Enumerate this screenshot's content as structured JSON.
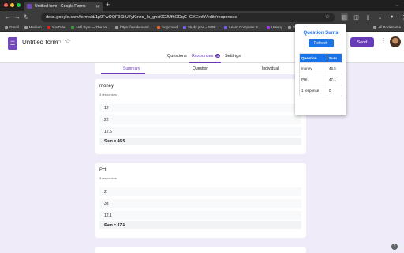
{
  "browser": {
    "tab_title": "Untitled form - Google Forms",
    "url": "docs.google.com/forms/d/1p9FwOQF9XkU7yKmzc_Ib_ghci0CJUfhODqC-lGXEmfY/edit#responses",
    "bookmarks": [
      "Gmail",
      "Medium",
      "YouTube",
      "Null Byte — The ea...",
      "https://alexkenan/t...",
      "bugcrowd",
      "Study plan - JetBr...",
      "Learn Computer S...",
      "Udemy",
      "Ve"
    ],
    "all_bookmarks_label": "All Bookmarks"
  },
  "header": {
    "form_title": "Untitled form",
    "send_label": "Send",
    "tabs": [
      {
        "label": "Questions"
      },
      {
        "label": "Responses",
        "badge": "3"
      },
      {
        "label": "Settings"
      }
    ]
  },
  "summary_tabs": [
    "Summary",
    "Question",
    "Individual"
  ],
  "questions": [
    {
      "title": "money",
      "count": "3 responses",
      "responses": [
        "12",
        "22",
        "12.5"
      ],
      "sum": "Sum = 46.5"
    },
    {
      "title": "PHI",
      "count": "3 responses",
      "responses": [
        "2",
        "33",
        "12.1"
      ],
      "sum": "Sum = 47.1"
    }
  ],
  "popup": {
    "title": "Question Sums",
    "refresh_label": "Refresh",
    "headers": [
      "Question",
      "Sum"
    ],
    "rows": [
      [
        "money",
        "46.5"
      ],
      [
        "PHI",
        "47.1"
      ],
      [
        "1 response",
        "0"
      ]
    ]
  },
  "colors": {
    "brand": "#673ab7",
    "popup_accent": "#1a73e8",
    "page_bg": "#f0ebf8"
  }
}
